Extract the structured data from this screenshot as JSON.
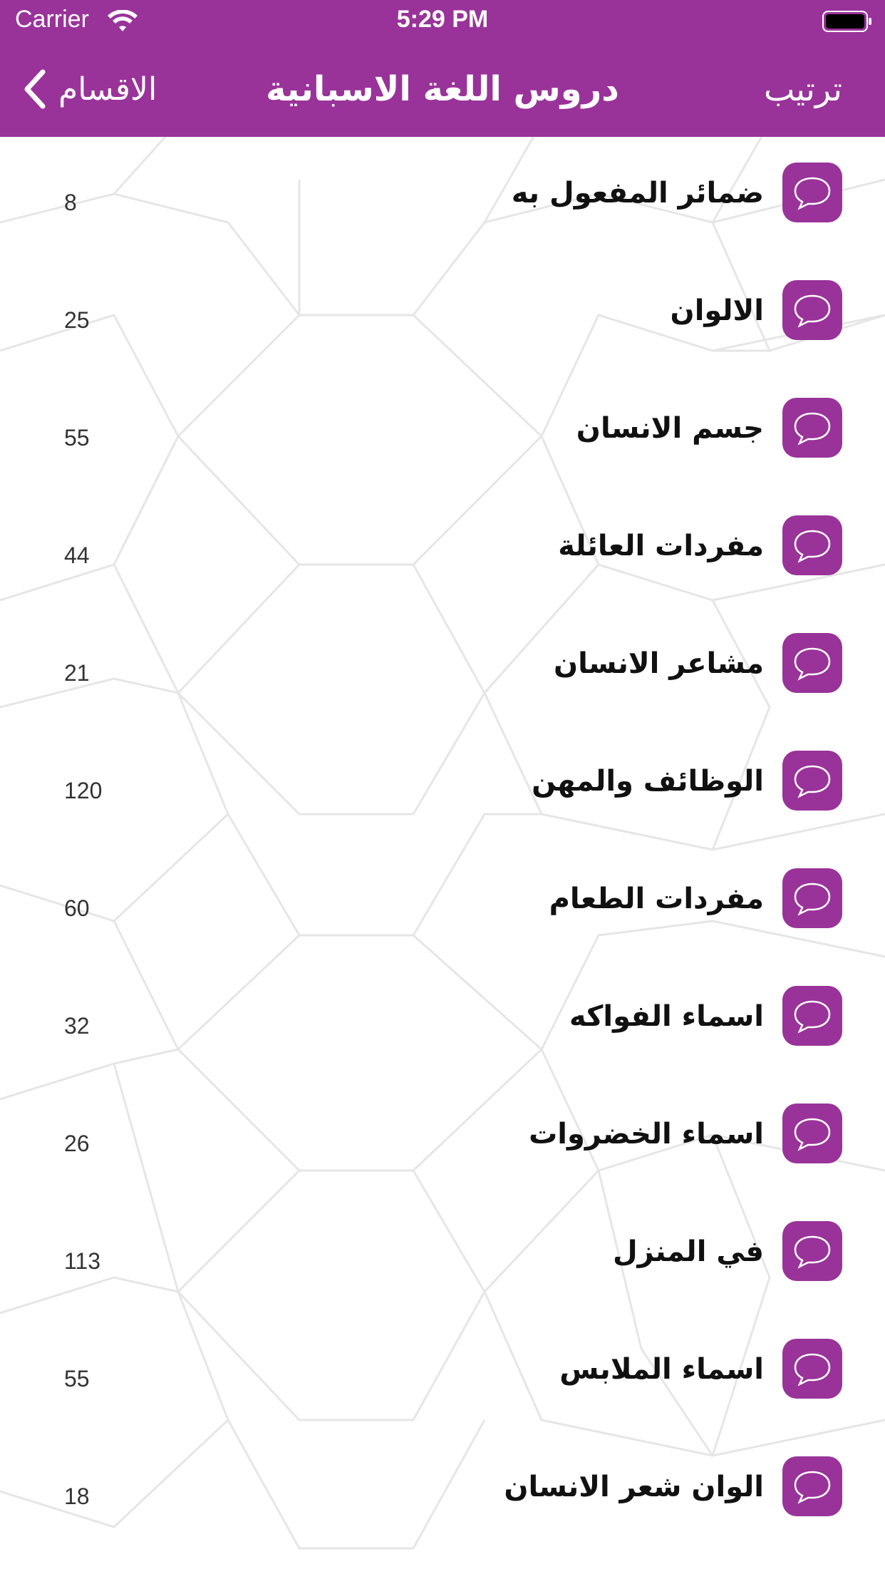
{
  "status_bar": {
    "carrier": "Carrier",
    "time": "5:29 PM"
  },
  "nav": {
    "back_label": "الاقسام",
    "title": "دروس اللغة الاسبانية",
    "sort_label": "ترتيب"
  },
  "colors": {
    "accent": "#993399",
    "background": "#ffffff",
    "text": "#111111"
  },
  "lessons": [
    {
      "title": "ضمائر المفعول به",
      "count": "8",
      "icon": "chat-bubble-icon"
    },
    {
      "title": "الالوان",
      "count": "25",
      "icon": "chat-bubble-icon"
    },
    {
      "title": "جسم الانسان",
      "count": "55",
      "icon": "chat-bubble-icon"
    },
    {
      "title": "مفردات العائلة",
      "count": "44",
      "icon": "chat-bubble-icon"
    },
    {
      "title": "مشاعر الانسان",
      "count": "21",
      "icon": "chat-bubble-icon"
    },
    {
      "title": "الوظائف والمهن",
      "count": "120",
      "icon": "chat-bubble-icon"
    },
    {
      "title": "مفردات الطعام",
      "count": "60",
      "icon": "chat-bubble-icon"
    },
    {
      "title": "اسماء الفواكه",
      "count": "32",
      "icon": "chat-bubble-icon"
    },
    {
      "title": "اسماء الخضروات",
      "count": "26",
      "icon": "chat-bubble-icon"
    },
    {
      "title": "في المنزل",
      "count": "113",
      "icon": "chat-bubble-icon"
    },
    {
      "title": "اسماء الملابس",
      "count": "55",
      "icon": "chat-bubble-icon"
    },
    {
      "title": "الوان شعر الانسان",
      "count": "18",
      "icon": "chat-bubble-icon"
    }
  ]
}
